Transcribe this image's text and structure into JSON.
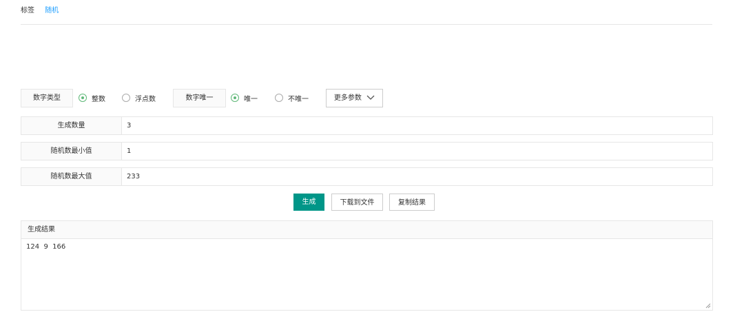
{
  "breadcrumb": {
    "item1": "标签",
    "item2": "随机"
  },
  "options": {
    "number_type_label": "数字类型",
    "integer": "整数",
    "float": "浮点数",
    "unique_label": "数字唯一",
    "unique": "唯一",
    "not_unique": "不唯一",
    "more_params": "更多参数"
  },
  "fields": {
    "count": {
      "label": "生成数量",
      "value": "3"
    },
    "min": {
      "label": "随机数最小值",
      "value": "1"
    },
    "max": {
      "label": "随机数最大值",
      "value": "233"
    }
  },
  "actions": {
    "generate": "生成",
    "download": "下载到文件",
    "copy": "复制结果"
  },
  "result": {
    "title": "生成结果",
    "content": "124  9  166"
  },
  "colors": {
    "accent": "#009688",
    "radio": "#5fb878",
    "link": "#1e9fff"
  }
}
